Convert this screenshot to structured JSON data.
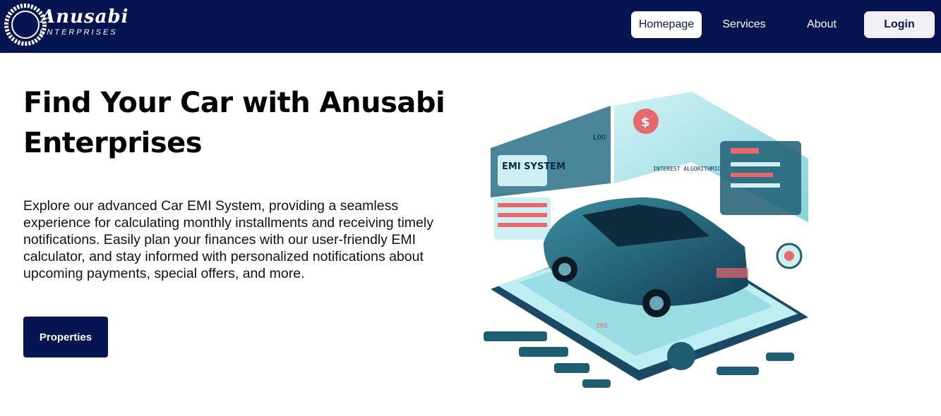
{
  "header": {
    "logo": {
      "name": "Anusabi",
      "tagline": "ENTERPRISES"
    },
    "nav": [
      {
        "label": "Homepage",
        "active": true
      },
      {
        "label": "Services"
      },
      {
        "label": "About"
      }
    ],
    "login_label": "Login"
  },
  "hero": {
    "title": "Find Your Car with Anusabi Enterprises",
    "description": "Explore our advanced Car EMI System, providing a seamless experience for calculating monthly installments and receiving timely notifications. Easily plan your finances with our user-friendly EMI calculator, and stay informed with personalized notifications about upcoming payments, special offers, and more.",
    "cta_label": "Properties",
    "illustration": {
      "heading": "EMI SYSTEM",
      "labels": [
        "INTEREST ALGORITHMIC",
        "LOO",
        "EMI"
      ]
    }
  },
  "colors": {
    "navy": "#061552",
    "teal": "#5fc3cf",
    "coral": "#e8696b"
  }
}
